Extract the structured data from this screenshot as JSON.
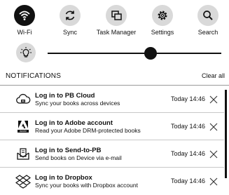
{
  "quick_actions": [
    {
      "label": "Wi-Fi",
      "icon": "wifi-icon",
      "active": true
    },
    {
      "label": "Sync",
      "icon": "sync-icon",
      "active": false
    },
    {
      "label": "Task Manager",
      "icon": "task-manager-icon",
      "active": false
    },
    {
      "label": "Settings",
      "icon": "gear-icon",
      "active": false
    },
    {
      "label": "Search",
      "icon": "search-icon",
      "active": false
    }
  ],
  "brightness": {
    "icon": "lightbulb-icon",
    "level": 0.56
  },
  "notifications": {
    "title": "NOTIFICATIONS",
    "clear_all": "Clear all",
    "items": [
      {
        "title": "Log in to PB Cloud",
        "subtitle": "Sync your books across devices",
        "time": "Today 14:46",
        "icon": "cloud-icon"
      },
      {
        "title": "Log in to Adobe account",
        "subtitle": "Read your Adobe DRM-protected books",
        "time": "Today 14:46",
        "icon": "adobe-icon"
      },
      {
        "title": "Log in to Send-to-PB",
        "subtitle": "Send books on Device via e-mail",
        "time": "Today 14:46",
        "icon": "send-icon"
      },
      {
        "title": "Log in to Dropbox",
        "subtitle": "Sync your books with Dropbox account",
        "time": "Today 14:46",
        "icon": "dropbox-icon"
      }
    ]
  },
  "colors": {
    "active": "#111111",
    "inactive": "#d9d9d9"
  }
}
